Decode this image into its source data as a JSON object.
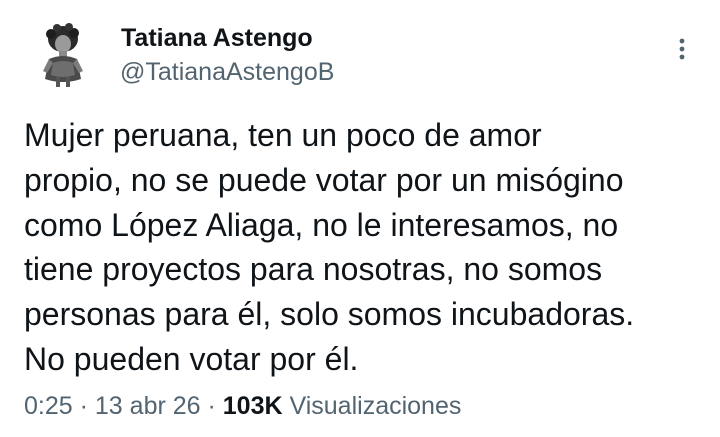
{
  "author": {
    "display_name": "Tatiana Astengo",
    "handle": "@TatianaAstengoB",
    "avatar_icon": "user-avatar-photo"
  },
  "menu": {
    "icon": "more-vertical-icon"
  },
  "tweet": {
    "lines": [
      "Mujer peruana, ten un poco de amor",
      "propio, no se puede votar por un misógino",
      "como López Aliaga, no le interesamos, no",
      "tiene proyectos para nosotras, no somos",
      "personas para él, solo somos incubadoras.",
      "No pueden votar por él."
    ]
  },
  "meta": {
    "time": "0:25",
    "separator": "·",
    "date": "13 abr 26",
    "views_count": "103K",
    "views_label": "Visualizaciones"
  },
  "colors": {
    "text_primary": "#0f1419",
    "text_secondary": "#536471",
    "background": "#ffffff"
  }
}
